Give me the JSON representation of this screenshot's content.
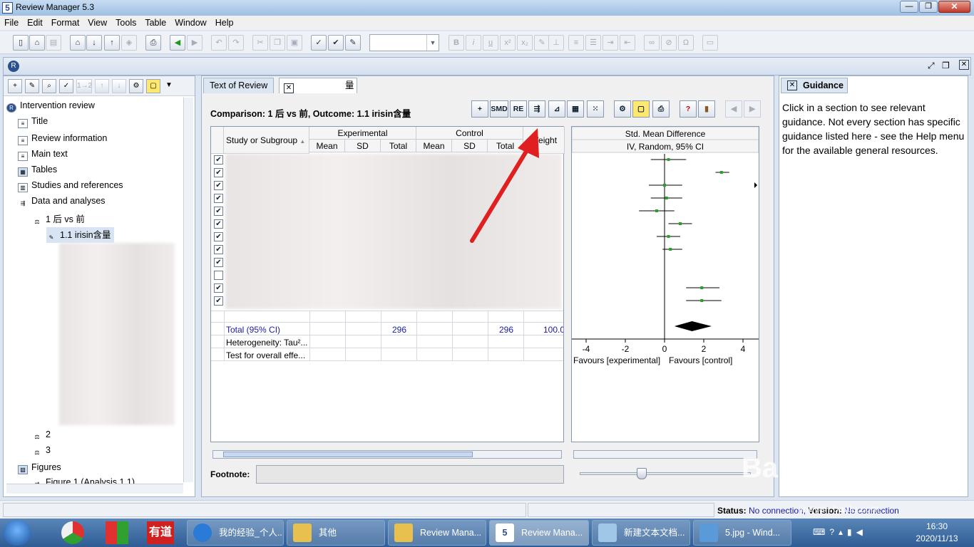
{
  "window": {
    "title": "Review Manager 5.3",
    "icon": "5",
    "minimize": "—",
    "maximize": "❐",
    "close": "✕"
  },
  "menu": [
    "File",
    "Edit",
    "Format",
    "View",
    "Tools",
    "Table",
    "Window",
    "Help"
  ],
  "toolbar": {
    "font_value": ""
  },
  "tree": {
    "root": "Intervention review",
    "items": [
      "Title",
      "Review information",
      "Main text",
      "Tables",
      "Studies and references",
      "Data and analyses"
    ],
    "comparison_1": "1 后 vs 前",
    "outcome_1_1": "1.1 irisin含量",
    "comparison_2": "2",
    "comparison_3": "3",
    "figures": "Figures",
    "figure_1": "Figure 1 (Analysis 1.1)"
  },
  "left_toolbar": {
    "numbering": "1→2"
  },
  "tabs": {
    "text_of_review": "Text of Review",
    "analysis_tab_suffix": "量"
  },
  "comparison_header": "Comparison: 1 后 vs 前, Outcome: 1.1 irisin含量",
  "analysis_toolbar": {
    "smd": "SMD",
    "re": "RE"
  },
  "table": {
    "study_col": "Study or Subgroup",
    "experimental": "Experimental",
    "control": "Control",
    "weight": "Weight",
    "mean": "Mean",
    "sd": "SD",
    "total": "Total",
    "checked_rows": [
      true,
      true,
      true,
      true,
      true,
      true,
      true,
      true,
      true,
      false,
      true,
      true
    ],
    "total_row": {
      "label": "Total (95% CI)",
      "exp_total": "296",
      "ctrl_total": "296",
      "weight": "100.0"
    },
    "heterogeneity": "Heterogeneity: Tau²...",
    "overall_effect": "Test for overall effe..."
  },
  "forest": {
    "title": "Std. Mean Difference",
    "subtitle": "IV, Random, 95% CI",
    "ticks": [
      "-4",
      "-2",
      "0",
      "2",
      "4"
    ],
    "favours_left": "Favours [experimental]",
    "favours_right": "Favours [control]"
  },
  "chart_data": {
    "type": "scatter",
    "title": "Std. Mean Difference",
    "subtitle": "IV, Random, 95% CI",
    "xlim": [
      -4,
      4
    ],
    "xticks": [
      -4,
      -2,
      0,
      2,
      4
    ],
    "studies": [
      {
        "est": 0.2,
        "lo": -0.7,
        "hi": 1.1
      },
      {
        "est": 2.9,
        "lo": 2.6,
        "hi": 3.3
      },
      {
        "est": 0.0,
        "lo": -0.8,
        "hi": 0.9
      },
      {
        "est": 0.1,
        "lo": -0.7,
        "hi": 0.9
      },
      {
        "est": -0.4,
        "lo": -1.3,
        "hi": 0.5
      },
      {
        "est": 0.8,
        "lo": 0.2,
        "hi": 1.4
      },
      {
        "est": 0.2,
        "lo": -0.4,
        "hi": 0.8
      },
      {
        "est": 0.3,
        "lo": -0.1,
        "hi": 0.9
      },
      {
        "est": 1.9,
        "lo": 1.1,
        "hi": 2.8
      },
      {
        "est": 1.9,
        "lo": 1.1,
        "hi": 2.9
      }
    ],
    "pooled": {
      "est": 1.4,
      "lo": 0.5,
      "hi": 2.4
    },
    "xlabel_left": "Favours [experimental]",
    "xlabel_right": "Favours [control]"
  },
  "guidance": {
    "title": "Guidance",
    "text": "Click in a section to see relevant guidance. Not every section has specific guidance listed here - see the Help menu for the available general resources."
  },
  "footnote_label": "Footnote:",
  "status": {
    "status_label": "Status:",
    "status_value": "No connection,",
    "version_label": "Version:",
    "version_value": "No connection"
  },
  "taskbar": {
    "youdao": "有道",
    "tasks": [
      "我的经验_个人...",
      "其他",
      "Review Mana...",
      "Review Mana...",
      "新建文本文档...",
      "5.jpg - Wind..."
    ],
    "time": "16:30",
    "date": "2020/11/13"
  },
  "watermark": {
    "brand": "Baidu经验",
    "url": "jingyan.baidu.com"
  },
  "colors": {
    "accent": "#1a1aa8",
    "arrow": "#e02020",
    "point": "#2aa02a"
  }
}
